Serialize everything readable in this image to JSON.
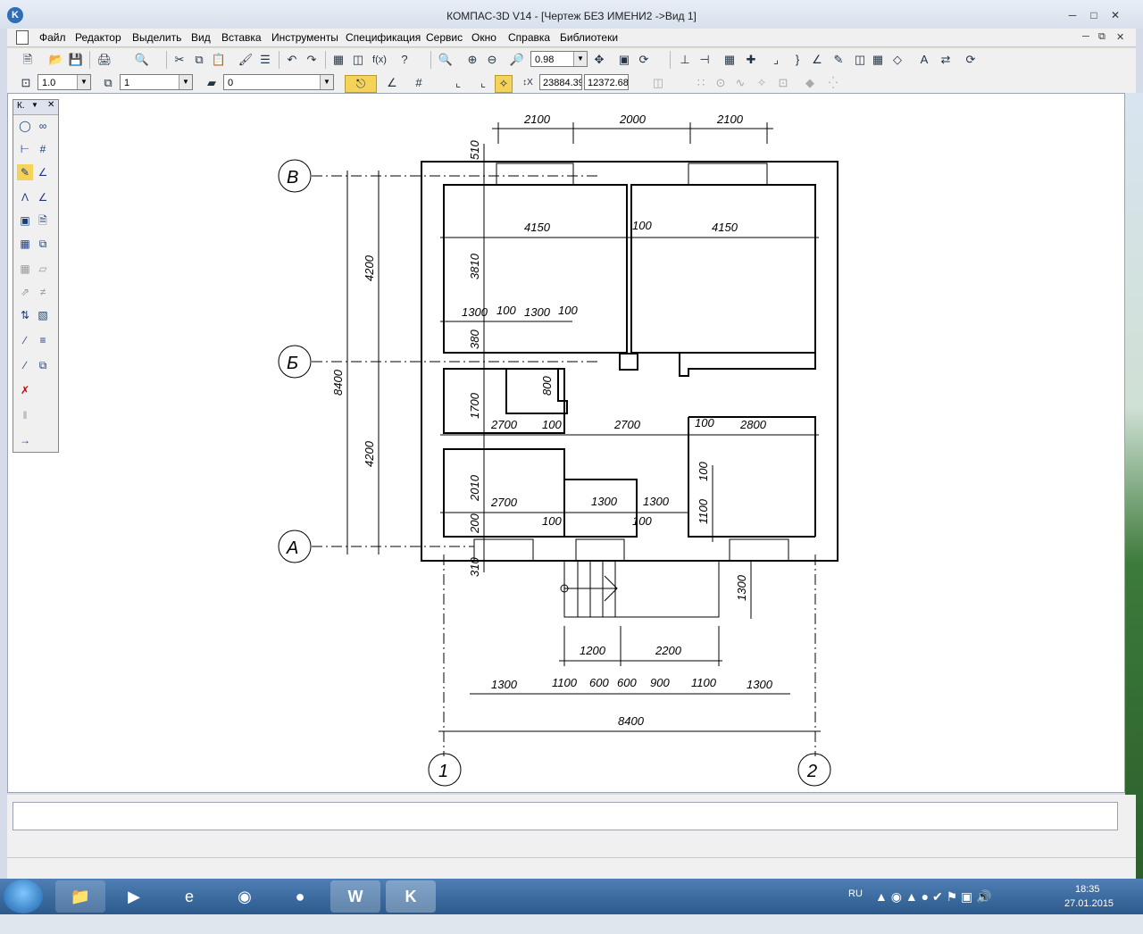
{
  "window": {
    "title": "КОМПАС-3D V14 - [Чертеж БЕЗ ИМЕНИ2 ->Вид 1]"
  },
  "menu": [
    "Файл",
    "Редактор",
    "Выделить",
    "Вид",
    "Вставка",
    "Инструменты",
    "Спецификация",
    "Сервис",
    "Окно",
    "Справка",
    "Библиотеки"
  ],
  "toolbar1": {
    "zoom_value": "0.98"
  },
  "toolbar2": {
    "scale_value": "1.0",
    "layer_value": "1",
    "style_value": "0",
    "coord_x": "23884.39",
    "coord_y": "12372.68"
  },
  "palette": {
    "header": "К."
  },
  "drawing": {
    "axis_labels": [
      "В",
      "Б",
      "А",
      "1",
      "2"
    ],
    "dims_top": [
      "2100",
      "2000",
      "2100"
    ],
    "dims_vertical_left": [
      "8400",
      "4200",
      "4200"
    ],
    "dims_internal": [
      "510",
      "4150",
      "100",
      "4150",
      "3810",
      "1300",
      "100",
      "1300",
      "100",
      "380",
      "800",
      "1700",
      "2700",
      "100",
      "2700",
      "100",
      "2800",
      "100",
      "2010",
      "2700",
      "1300",
      "1300",
      "100",
      "100",
      "1100",
      "200",
      "310",
      "1300"
    ],
    "dims_bottom_stair": [
      "1200",
      "2200"
    ],
    "dims_bottom_row": [
      "1300",
      "1100",
      "600",
      "600",
      "900",
      "1100",
      "1300"
    ],
    "dims_total": "8400"
  },
  "taskbar": {
    "lang": "RU",
    "time": "18:35",
    "date": "27.01.2015"
  }
}
